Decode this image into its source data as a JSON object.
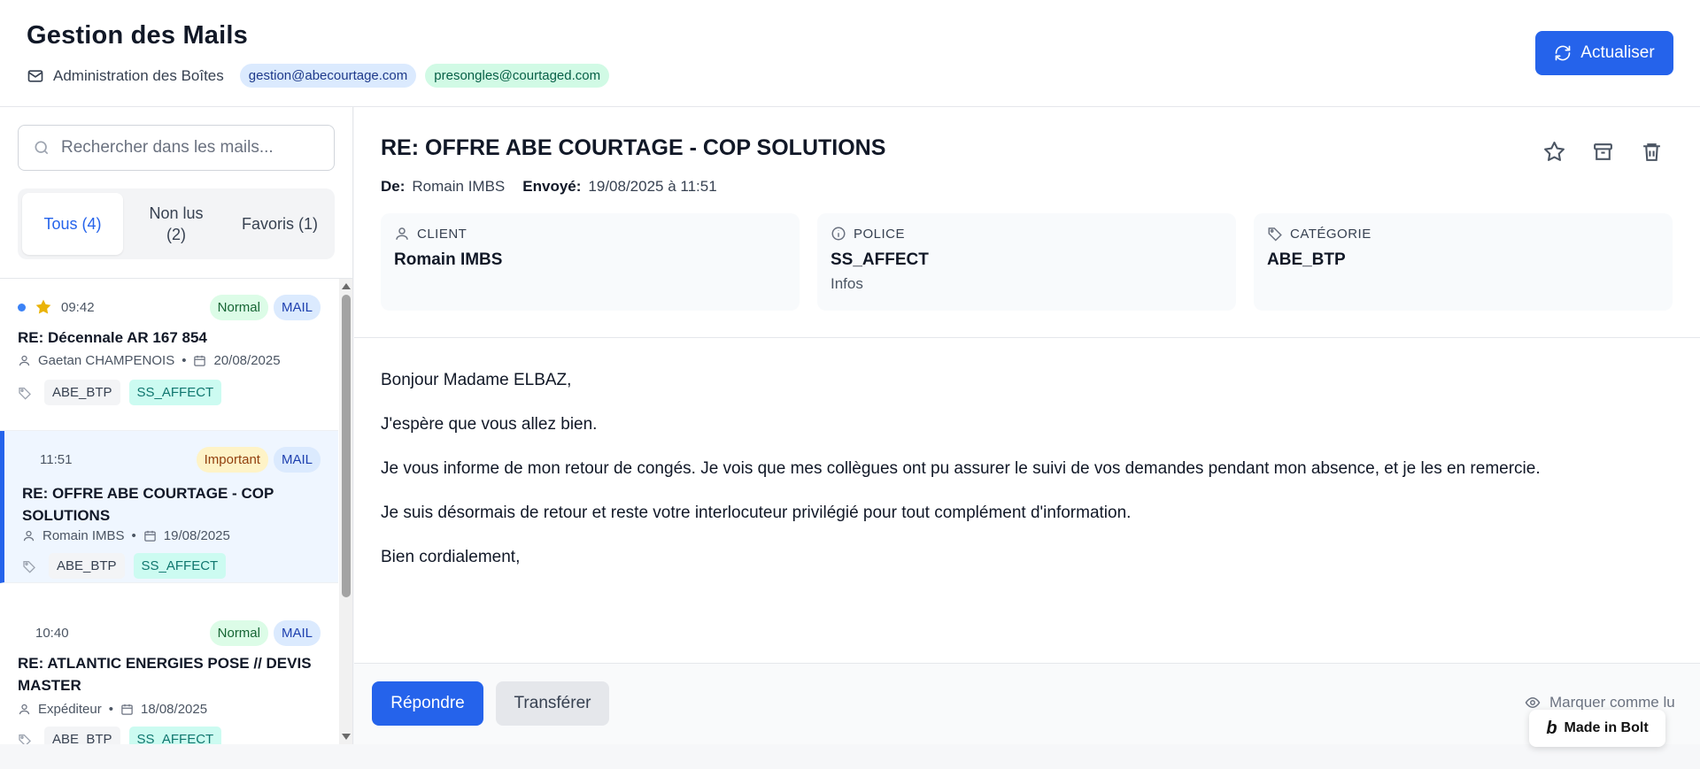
{
  "header": {
    "title": "Gestion des Mails",
    "subtitle": "Administration des Boîtes",
    "mailboxes": [
      "gestion@abecourtage.com",
      "presongles@courtaged.com"
    ],
    "refresh_label": "Actualiser"
  },
  "sidebar": {
    "search_placeholder": "Rechercher dans les mails...",
    "tabs": [
      {
        "label": "Tous (4)",
        "active": true
      },
      {
        "label": "Non lus (2)",
        "active": false
      },
      {
        "label": "Favoris (1)",
        "active": false
      }
    ],
    "mails": [
      {
        "time": "09:42",
        "unread": true,
        "starred": true,
        "priority": "Normal",
        "type": "MAIL",
        "subject": "RE: Décennale AR 167 854",
        "sender": "Gaetan CHAMPENOIS",
        "date": "20/08/2025",
        "tags": [
          "ABE_BTP",
          "SS_AFFECT"
        ]
      },
      {
        "time": "11:51",
        "unread": false,
        "starred": false,
        "priority": "Important",
        "type": "MAIL",
        "subject": "RE: OFFRE ABE COURTAGE - COP SOLUTIONS",
        "sender": "Romain IMBS",
        "date": "19/08/2025",
        "tags": [
          "ABE_BTP",
          "SS_AFFECT"
        ],
        "selected": true
      },
      {
        "time": "10:40",
        "unread": false,
        "starred": false,
        "priority": "Normal",
        "type": "MAIL",
        "subject": "RE: ATLANTIC ENERGIES POSE // DEVIS MASTER",
        "sender": "Expéditeur",
        "date": "18/08/2025",
        "tags": [
          "ABE_BTP",
          "SS_AFFECT"
        ]
      }
    ]
  },
  "detail": {
    "subject": "RE: OFFRE ABE COURTAGE - COP SOLUTIONS",
    "from_label": "De:",
    "from": "Romain IMBS",
    "sent_label": "Envoyé:",
    "sent": "19/08/2025 à 11:51",
    "cards": {
      "client": {
        "label": "CLIENT",
        "value": "Romain IMBS"
      },
      "police": {
        "label": "POLICE",
        "value": "SS_AFFECT",
        "sub": "Infos"
      },
      "categorie": {
        "label": "CATÉGORIE",
        "value": "ABE_BTP"
      }
    },
    "body": [
      "Bonjour Madame ELBAZ,",
      "J'espère que vous allez bien.",
      "Je vous informe de mon retour de congés. Je vois que mes collègues ont pu assurer le suivi de vos demandes pendant mon absence, et je les en remercie.",
      "Je suis désormais de retour et reste votre interlocuteur privilégié pour tout complément d'information.",
      "Bien cordialement,"
    ],
    "reply_label": "Répondre",
    "forward_label": "Transférer",
    "mark_read_label": "Marquer comme lu"
  },
  "bolt_badge": "Made in Bolt",
  "colors": {
    "accent": "#2563eb",
    "unread_dot": "#3b82f6",
    "star": "#eab308"
  }
}
